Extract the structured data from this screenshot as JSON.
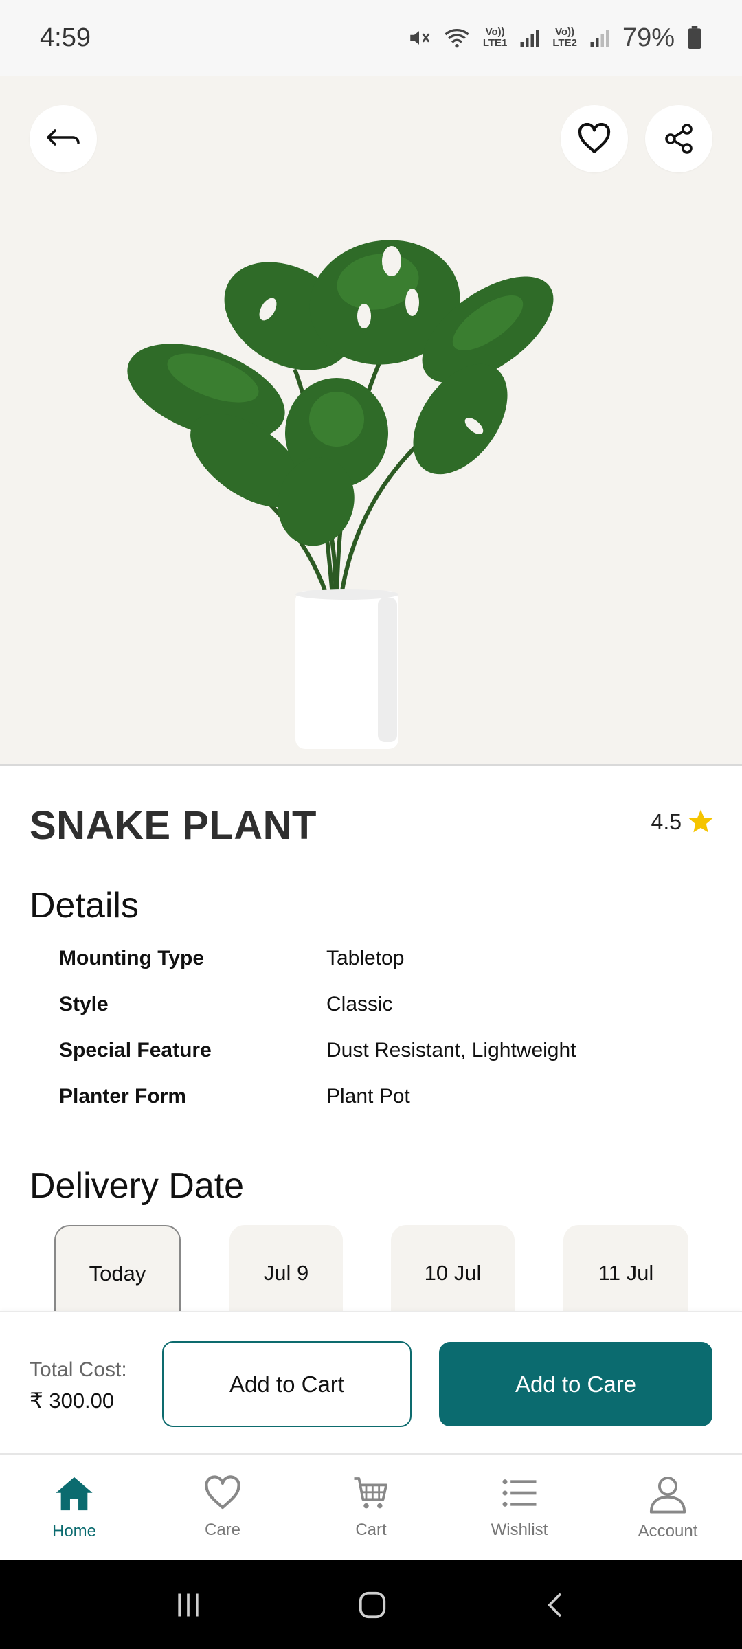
{
  "status_bar": {
    "time": "4:59",
    "lte1": "Vo))\nLTE1",
    "lte2": "Vo))\nLTE2",
    "battery": "79%"
  },
  "product": {
    "name": "SNAKE PLANT",
    "rating": "4.5"
  },
  "details": {
    "heading": "Details",
    "rows": [
      {
        "key": "Mounting Type",
        "value": "Tabletop"
      },
      {
        "key": "Style",
        "value": "Classic"
      },
      {
        "key": "Special Feature",
        "value": "Dust Resistant, Lightweight"
      },
      {
        "key": "Planter Form",
        "value": "Plant Pot"
      }
    ]
  },
  "delivery": {
    "heading": "Delivery Date",
    "dates": [
      "Today",
      "Jul 9",
      "10 Jul",
      "11 Jul"
    ],
    "selected": "Today"
  },
  "cart": {
    "total_label": "Total Cost:",
    "total_value": "₹ 300.00",
    "add_to_cart": "Add to Cart",
    "add_to_care": "Add to Care"
  },
  "nav": {
    "items": [
      {
        "label": "Home",
        "icon": "home-icon",
        "active": true
      },
      {
        "label": "Care",
        "icon": "heart-icon",
        "active": false
      },
      {
        "label": "Cart",
        "icon": "cart-icon",
        "active": false
      },
      {
        "label": "Wishlist",
        "icon": "list-icon",
        "active": false
      },
      {
        "label": "Account",
        "icon": "person-icon",
        "active": false
      }
    ]
  },
  "colors": {
    "accent": "#0b6b6f",
    "hero_bg": "#f5f3ef",
    "star": "#f5c400"
  }
}
